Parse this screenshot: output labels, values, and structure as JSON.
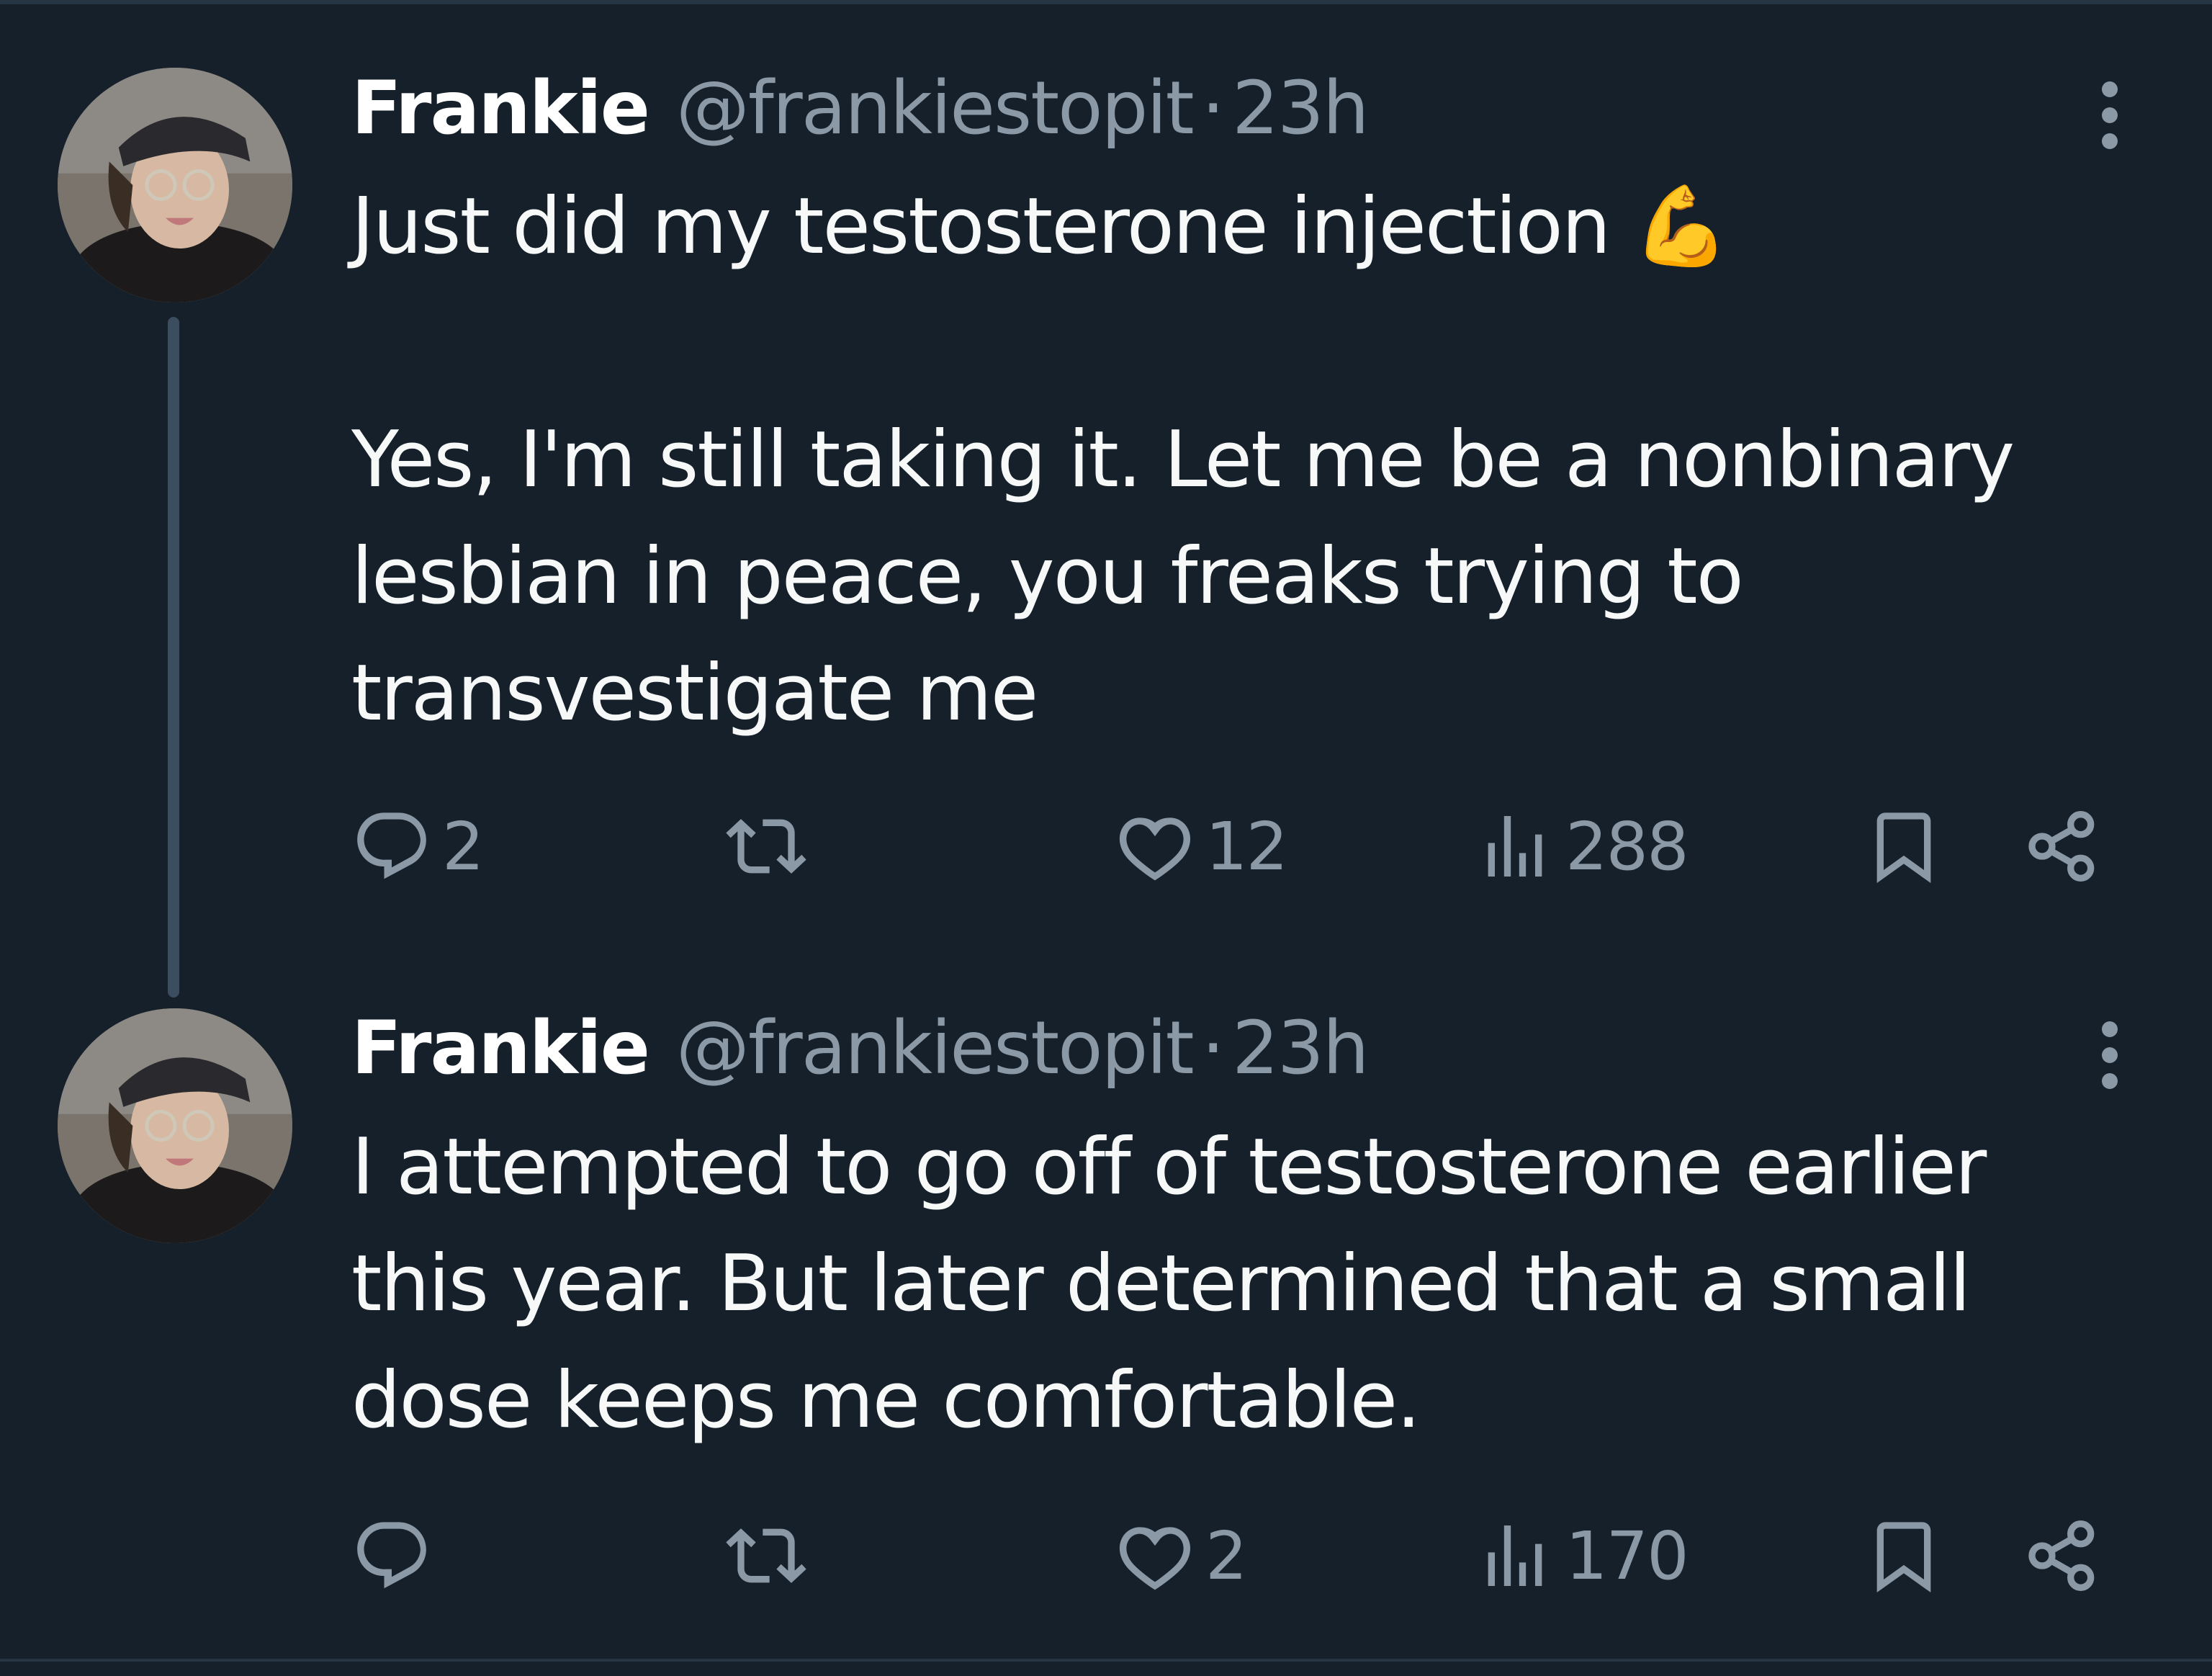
{
  "tweets": [
    {
      "author": {
        "name": "Frankie",
        "handle": "@frankiestopit",
        "separator": "·",
        "time": "23h"
      },
      "text": "Just did my testosterone injection 💪\n\nYes, I'm still taking it. Let me be a nonbinary lesbian in peace, you freaks trying to transvestigate me",
      "metrics": {
        "replies": "2",
        "retweets": "",
        "likes": "12",
        "views": "288"
      }
    },
    {
      "author": {
        "name": "Frankie",
        "handle": "@frankiestopit",
        "separator": "·",
        "time": "23h"
      },
      "text": "I attempted to go off of testosterone earlier this year. But later determined that a small dose keeps me comfortable.",
      "metrics": {
        "replies": "",
        "retweets": "",
        "likes": "2",
        "views": "170"
      }
    }
  ],
  "colors": {
    "background": "#15202b",
    "primary_text": "#f7f9f9",
    "secondary_text": "#8b98a5",
    "thread_line": "#3c4d5f"
  },
  "icons": [
    "more-options-icon",
    "reply-icon",
    "retweet-icon",
    "like-icon",
    "views-icon",
    "bookmark-icon",
    "share-icon"
  ]
}
